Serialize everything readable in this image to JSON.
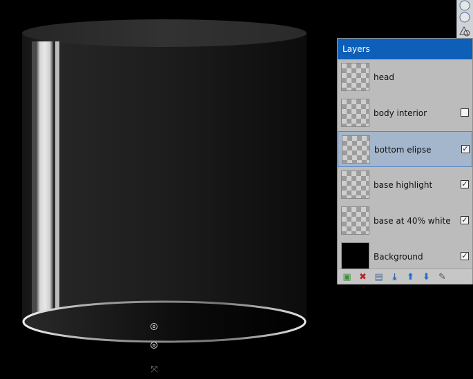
{
  "layers_panel": {
    "title": "Layers",
    "layers": [
      {
        "name": "head",
        "visible": null,
        "selected": false,
        "thumb": "transparent"
      },
      {
        "name": "body interior",
        "visible": false,
        "selected": false,
        "thumb": "transparent"
      },
      {
        "name": "bottom elipse",
        "visible": true,
        "selected": true,
        "thumb": "transparent"
      },
      {
        "name": "base highlight",
        "visible": true,
        "selected": false,
        "thumb": "transparent"
      },
      {
        "name": "base at 40% white",
        "visible": true,
        "selected": false,
        "thumb": "transparent"
      },
      {
        "name": "Background",
        "visible": true,
        "selected": false,
        "thumb": "black"
      }
    ],
    "toolbar": [
      {
        "name": "add-layer-icon",
        "glyph": "▣",
        "color": "#3f8f3f"
      },
      {
        "name": "delete-layer-icon",
        "glyph": "✖",
        "color": "#c02020"
      },
      {
        "name": "duplicate-layer-icon",
        "glyph": "▤",
        "color": "#4a6f9a"
      },
      {
        "name": "merge-layer-down-icon",
        "glyph": "⤓",
        "color": "#2b5fa8"
      },
      {
        "name": "move-layer-up-icon",
        "glyph": "⬆",
        "color": "#1f6fd0"
      },
      {
        "name": "move-layer-down-icon",
        "glyph": "⬇",
        "color": "#1f6fd0"
      },
      {
        "name": "layer-properties-icon",
        "glyph": "✎",
        "color": "#555555"
      }
    ]
  },
  "colors": {
    "titlebar": "#0d5fb8",
    "selected_row": "#a4b6cc",
    "canvas_bg": "#000000"
  },
  "tools_strip": {
    "icons": [
      "ellipse-select-icon",
      "ellipse-tool-icon",
      "shapes-tool-icon",
      "primary-color-icon",
      "secondary-color-icon",
      "small-toggle-icon"
    ]
  }
}
